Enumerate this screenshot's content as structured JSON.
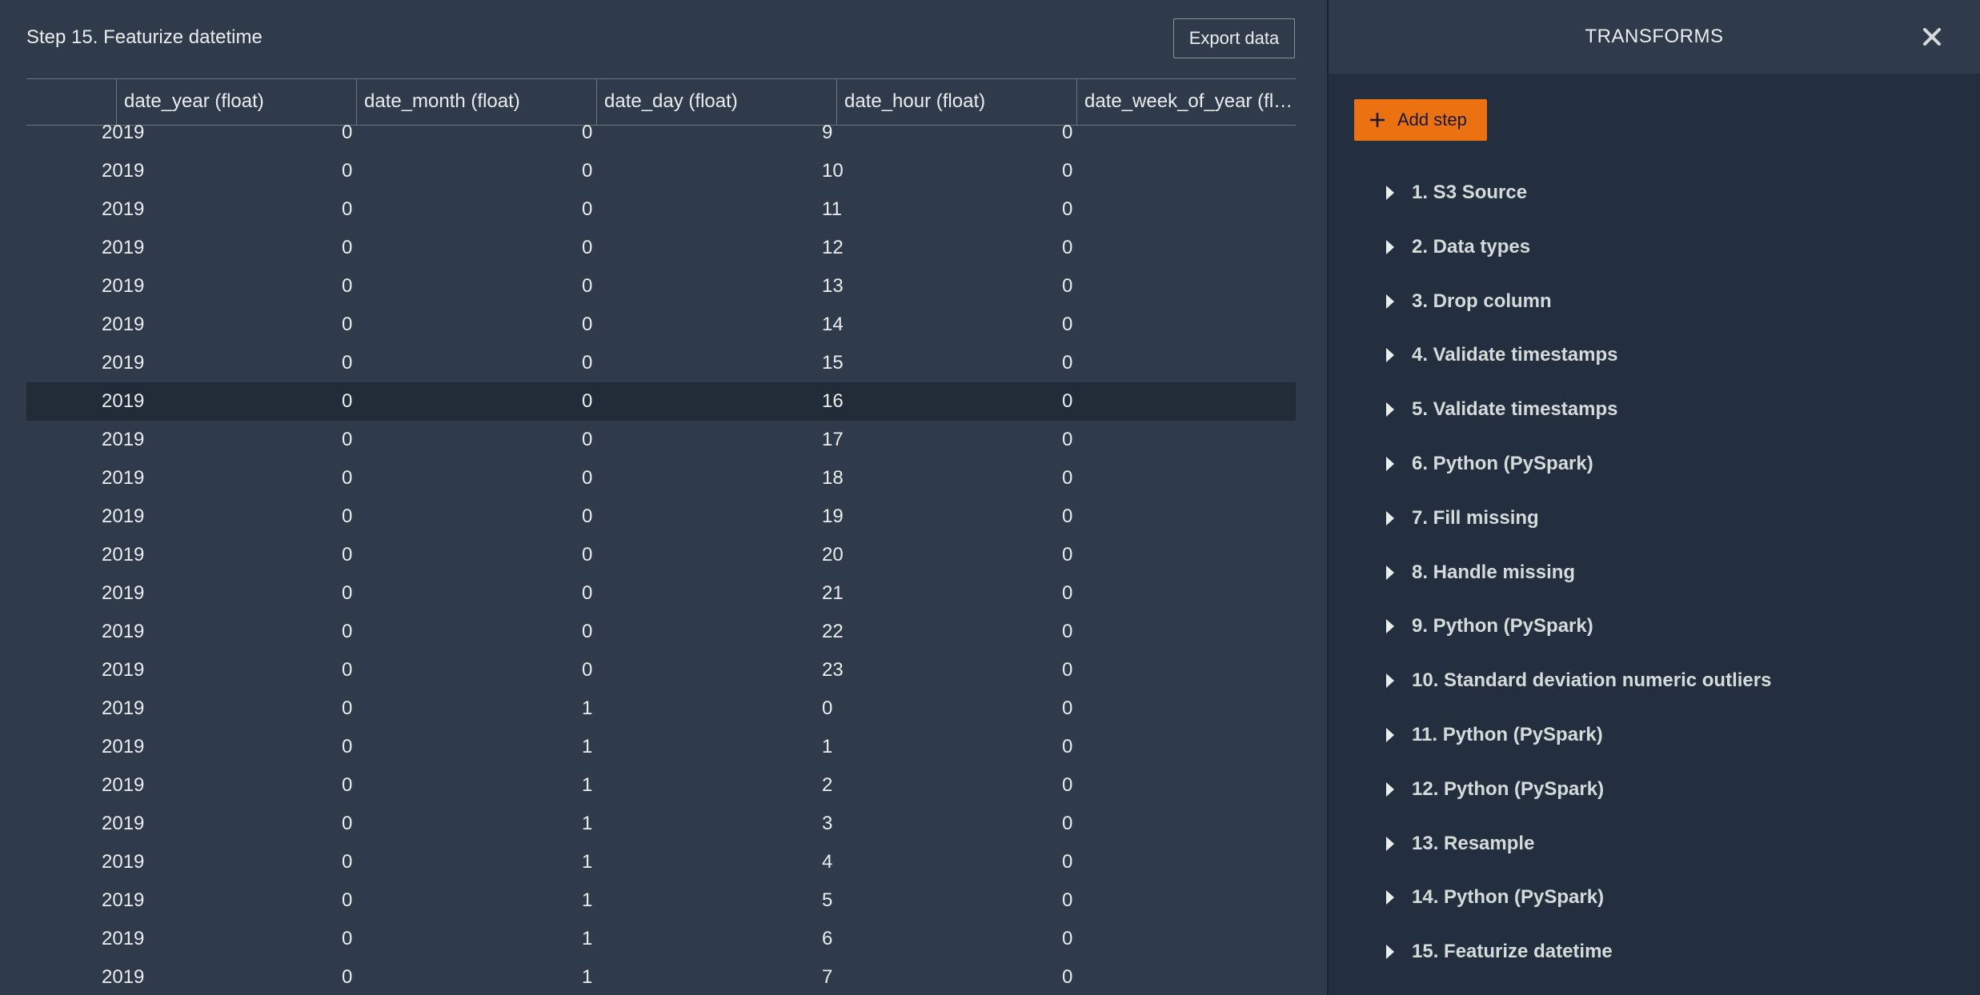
{
  "main": {
    "step_title": "Step 15. Featurize datetime",
    "export_label": "Export data",
    "columns": [
      "date_year (float)",
      "date_month (float)",
      "date_day (float)",
      "date_hour (float)",
      "date_week_of_year (fl…"
    ],
    "selected_row_index": 7,
    "rows": [
      [
        "2019",
        "0",
        "0",
        "9",
        "0"
      ],
      [
        "2019",
        "0",
        "0",
        "10",
        "0"
      ],
      [
        "2019",
        "0",
        "0",
        "11",
        "0"
      ],
      [
        "2019",
        "0",
        "0",
        "12",
        "0"
      ],
      [
        "2019",
        "0",
        "0",
        "13",
        "0"
      ],
      [
        "2019",
        "0",
        "0",
        "14",
        "0"
      ],
      [
        "2019",
        "0",
        "0",
        "15",
        "0"
      ],
      [
        "2019",
        "0",
        "0",
        "16",
        "0"
      ],
      [
        "2019",
        "0",
        "0",
        "17",
        "0"
      ],
      [
        "2019",
        "0",
        "0",
        "18",
        "0"
      ],
      [
        "2019",
        "0",
        "0",
        "19",
        "0"
      ],
      [
        "2019",
        "0",
        "0",
        "20",
        "0"
      ],
      [
        "2019",
        "0",
        "0",
        "21",
        "0"
      ],
      [
        "2019",
        "0",
        "0",
        "22",
        "0"
      ],
      [
        "2019",
        "0",
        "0",
        "23",
        "0"
      ],
      [
        "2019",
        "0",
        "1",
        "0",
        "0"
      ],
      [
        "2019",
        "0",
        "1",
        "1",
        "0"
      ],
      [
        "2019",
        "0",
        "1",
        "2",
        "0"
      ],
      [
        "2019",
        "0",
        "1",
        "3",
        "0"
      ],
      [
        "2019",
        "0",
        "1",
        "4",
        "0"
      ],
      [
        "2019",
        "0",
        "1",
        "5",
        "0"
      ],
      [
        "2019",
        "0",
        "1",
        "6",
        "0"
      ],
      [
        "2019",
        "0",
        "1",
        "7",
        "0"
      ]
    ]
  },
  "side": {
    "title": "TRANSFORMS",
    "close_icon": "close-icon",
    "add_step_label": "Add step",
    "steps": [
      "1. S3 Source",
      "2. Data types",
      "3. Drop column",
      "4. Validate timestamps",
      "5. Validate timestamps",
      "6. Python (PySpark)",
      "7. Fill missing",
      "8. Handle missing",
      "9. Python (PySpark)",
      "10. Standard deviation numeric outliers",
      "11. Python (PySpark)",
      "12. Python (PySpark)",
      "13. Resample",
      "14. Python (PySpark)",
      "15. Featurize datetime"
    ]
  },
  "colors": {
    "main_bg": "#2f3a4b",
    "side_bg": "#232f3e",
    "selected_row": "#222b38",
    "accent": "#ec7211",
    "text": "#eaeded"
  }
}
